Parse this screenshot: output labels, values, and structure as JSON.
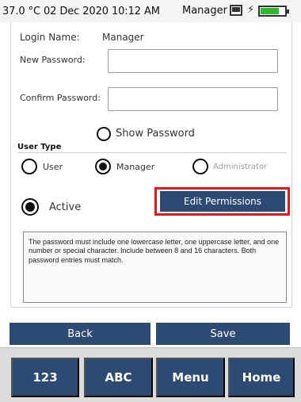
{
  "status_bar": {
    "left_text": "37.0 °C 02 Dec 2020 10:12 AM",
    "user": "Manager",
    "battery_level": 0.8,
    "battery_color": "#2db82d",
    "icons": [
      "monitor-icon",
      "plug-icon",
      "battery-icon"
    ]
  },
  "form": {
    "login_name_label": "Login Name:",
    "login_name_value": "Manager",
    "new_password_label": "New Password:",
    "new_password_value": "",
    "confirm_password_label": "Confirm Password:",
    "confirm_password_value": "",
    "show_password_label": "Show Password",
    "show_password_checked": false
  },
  "user_type": {
    "title": "User Type",
    "options": [
      {
        "label": "User",
        "checked": false,
        "disabled": false
      },
      {
        "label": "Manager",
        "checked": true,
        "disabled": false
      },
      {
        "label": "Administrator",
        "checked": false,
        "disabled": true
      }
    ]
  },
  "active": {
    "label": "Active",
    "checked": true
  },
  "edit_permissions_label": "Edit Permissions",
  "info_text": "The password must include one lowercase letter, one uppercase letter, and one number or special character. Include between 8 and 16 characters. Both password entries must match.",
  "actions": {
    "back_label": "Back",
    "save_label": "Save"
  },
  "keys": [
    "123",
    "ABC",
    "Menu",
    "Home"
  ],
  "colors": {
    "button": "#2d4a72",
    "highlight": "#e0191c",
    "disabled_text": "#9a9a9a"
  }
}
